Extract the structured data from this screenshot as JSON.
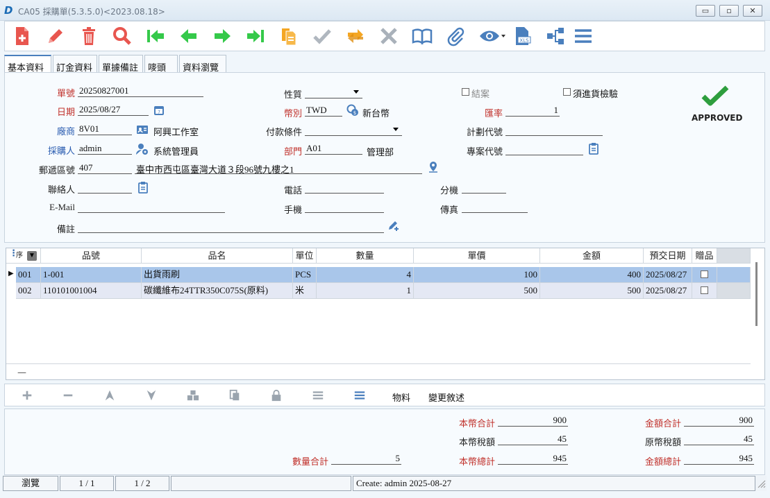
{
  "window": {
    "title": "CA05 採購單(5.3.5.0)<2023.08.18>",
    "logo": "D",
    "min": "▭",
    "max": "▫",
    "close": "✕"
  },
  "tabs": [
    "基本資料",
    "訂金資料",
    "單據備註",
    "嘜頭",
    "資料瀏覽"
  ],
  "form": {
    "order_no_label": "單號",
    "order_no": "20250827001",
    "date_label": "日期",
    "date": "2025/08/27",
    "vendor_label": "廠商",
    "vendor_code": "8V01",
    "vendor_name": "阿興工作室",
    "buyer_label": "採購人",
    "buyer": "admin",
    "buyer_name": "系統管理員",
    "zip_label": "郵遞區號",
    "zip": "407",
    "address": "臺中市西屯區臺灣大道３段96號九樓之1",
    "contact_label": "聯絡人",
    "contact": "",
    "email_label": "E-Mail",
    "email": "",
    "remark_label": "備註",
    "remark": "",
    "nature_label": "性質",
    "nature": "",
    "currency_label": "幣別",
    "currency": "TWD",
    "currency_name": "新台幣",
    "payment_label": "付款條件",
    "payment": "",
    "dept_label": "部門",
    "dept": "A01",
    "dept_name": "管理部",
    "phone_label": "電話",
    "phone": "",
    "mobile_label": "手機",
    "mobile": "",
    "closed_label": "結案",
    "inspection_label": "須進貨檢驗",
    "rate_label": "匯率",
    "rate": "1",
    "plan_label": "計劃代號",
    "plan": "",
    "project_label": "專案代號",
    "project": "",
    "ext_label": "分機",
    "ext": "",
    "fax_label": "傳真",
    "fax": "",
    "approved": "APPROVED"
  },
  "grid": {
    "headers": [
      "序",
      "品號",
      "品名",
      "單位",
      "數量",
      "單價",
      "金額",
      "預交日期",
      "贈品"
    ],
    "rows": [
      {
        "seq": "001",
        "code": "1-001",
        "name": "出貨雨刷",
        "unit": "PCS",
        "qty": "4",
        "price": "100",
        "amount": "400",
        "date": "2025/08/27"
      },
      {
        "seq": "002",
        "code": "110101001004",
        "name": "碳纖維布24TTR350C075S(原料)",
        "unit": "米",
        "qty": "1",
        "price": "500",
        "amount": "500",
        "date": "2025/08/27"
      }
    ],
    "footer_mark": "—"
  },
  "gridbar": {
    "material": "物料",
    "change_log": "變更敘述"
  },
  "totals": {
    "qty_label": "數量合計",
    "qty": "5",
    "local_total_label": "本幣合計",
    "local_total": "900",
    "local_tax_label": "本幣稅額",
    "local_tax": "45",
    "local_grand_label": "本幣總計",
    "local_grand": "945",
    "amount_total_label": "金額合計",
    "amount_total": "900",
    "orig_tax_label": "原幣稅額",
    "orig_tax": "45",
    "amount_grand_label": "金額總計",
    "amount_grand": "945"
  },
  "status": {
    "mode": "瀏覽",
    "record": "1 / 1",
    "page": "1 / 2",
    "created": "Create: admin 2025-08-27"
  },
  "colors": {
    "accent": "#2a5cb0",
    "label_red": "#c0302a",
    "selected_row": "#a9c6ea",
    "approved": "#2e9e3e"
  }
}
